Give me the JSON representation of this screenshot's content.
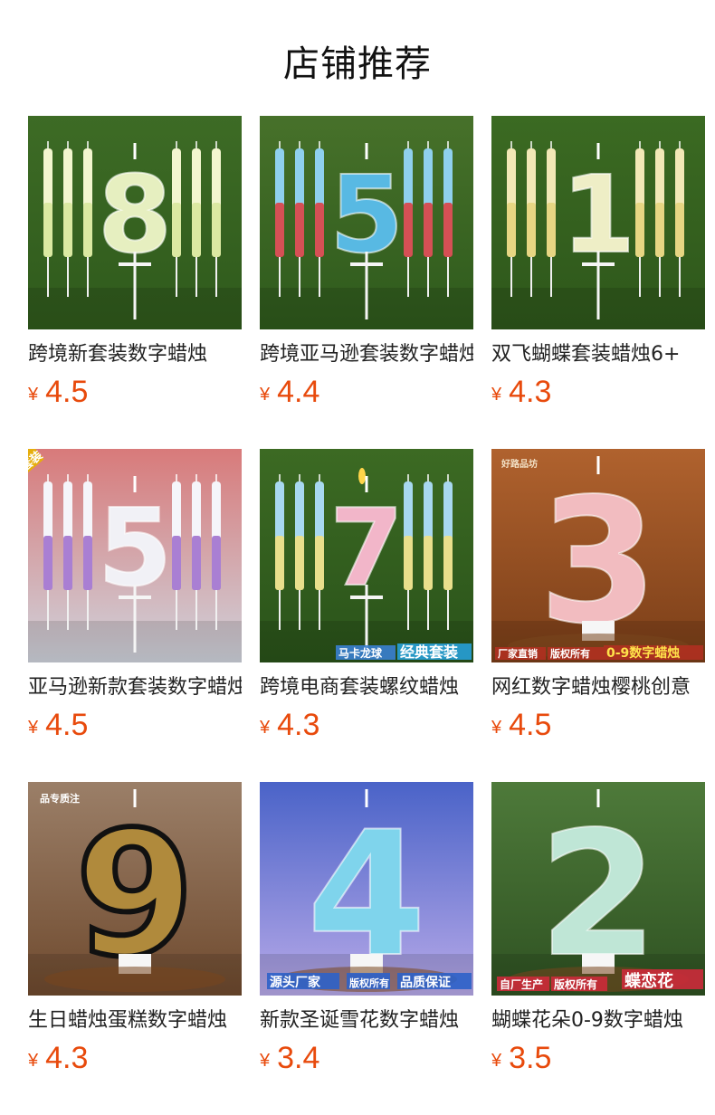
{
  "header": {
    "title": "店铺推荐"
  },
  "products": [
    {
      "name": "跨境新套装数字蜡烛",
      "currency": "¥",
      "price": "4.5",
      "digit": "8",
      "bg_top": "#3d6b25",
      "bg_bottom": "#2f5a1c",
      "digit_color": "#e6efc0",
      "candle_color": "#f3f6cf",
      "candle_band": "#d6e69a",
      "overlay": []
    },
    {
      "name": "跨境亚马逊套装数字蜡烛",
      "currency": "¥",
      "price": "4.4",
      "digit": "5",
      "bg_top": "#47712a",
      "bg_bottom": "#2e5a1c",
      "digit_color": "#58b9e3",
      "candle_color": "#8fd0ee",
      "candle_band": "#e23a3a",
      "overlay": []
    },
    {
      "name": "双飞蝴蝶套装蜡烛6+",
      "currency": "¥",
      "price": "4.3",
      "digit": "1",
      "bg_top": "#3b6a22",
      "bg_bottom": "#2e571b",
      "digit_color": "#eeeec6",
      "candle_color": "#f2e8b6",
      "candle_band": "#e5d27a",
      "overlay": []
    },
    {
      "name": "亚马逊新款套装数字蜡烛",
      "currency": "¥",
      "price": "4.5",
      "digit": "5",
      "bg_top": "#d87a7a",
      "bg_bottom": "#cfd3dc",
      "digit_color": "#f1f1f6",
      "candle_color": "#f5f5fa",
      "candle_band": "#9b6acb",
      "overlay": [
        "套装"
      ]
    },
    {
      "name": "跨境电商套装螺纹蜡烛",
      "currency": "¥",
      "price": "4.3",
      "digit": "7",
      "bg_top": "#3c6a23",
      "bg_bottom": "#2a531a",
      "digit_color": "#f2b6c9",
      "candle_color": "#a8d8f0",
      "candle_band": "#f4e07a",
      "overlay": [
        "马卡龙球",
        "经典套装"
      ]
    },
    {
      "name": "网红数字蜡烛樱桃创意",
      "currency": "¥",
      "price": "4.5",
      "digit": "3",
      "bg_top": "#b0622e",
      "bg_bottom": "#7a3e18",
      "digit_color": "#f2bcc0",
      "candle_color": "#ffffff",
      "candle_band": "#ffffff",
      "overlay": [
        "好路品坊",
        "厂家直销",
        "版权所有",
        "0-9数字蜡烛"
      ]
    },
    {
      "name": "生日蜡烛蛋糕数字蜡烛",
      "currency": "¥",
      "price": "4.3",
      "digit": "9",
      "bg_top": "#9b7f68",
      "bg_bottom": "#6f4a2e",
      "digit_color": "#b08a3c",
      "candle_color": "#ffffff",
      "candle_band": "#ffffff",
      "overlay": [
        "品专质注"
      ]
    },
    {
      "name": "新款圣诞雪花数字蜡烛",
      "currency": "¥",
      "price": "3.4",
      "digit": "4",
      "bg_top": "#4a63c8",
      "bg_bottom": "#b7a9e8",
      "digit_color": "#7fd4ec",
      "candle_color": "#ffffff",
      "candle_band": "#ffffff",
      "overlay": [
        "源头厂家",
        "版权所有",
        "品质保证"
      ]
    },
    {
      "name": "蝴蝶花朵0-9数字蜡烛",
      "currency": "¥",
      "price": "3.5",
      "digit": "2",
      "bg_top": "#4e7a3a",
      "bg_bottom": "#2f5222",
      "digit_color": "#bfe6d6",
      "candle_color": "#ffffff",
      "candle_band": "#ffffff",
      "overlay": [
        "自厂生产",
        "版权所有",
        "蝶恋花"
      ]
    }
  ]
}
